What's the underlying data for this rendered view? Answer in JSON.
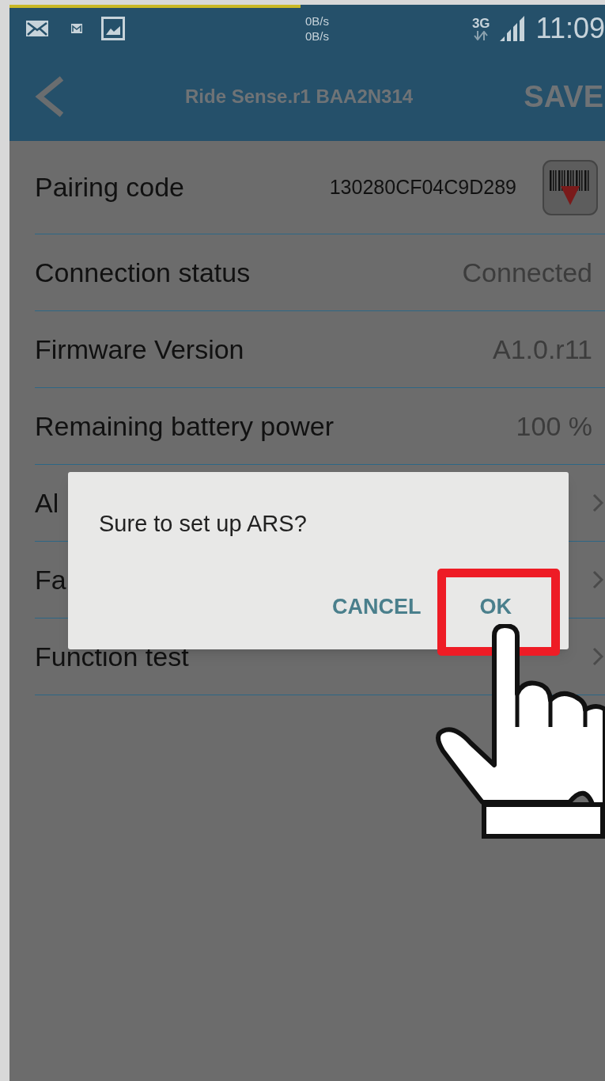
{
  "status_bar": {
    "net_up": "0B/s",
    "net_down": "0B/s",
    "network": "3G",
    "time": "11:09"
  },
  "app_bar": {
    "title": "Ride Sense.r1 BAA2N314",
    "action": "SAVE"
  },
  "rows": [
    {
      "kind": "code",
      "label": "Pairing code",
      "value": "130280CF04C9D289"
    },
    {
      "kind": "value",
      "label": "Connection status",
      "value": "Connected"
    },
    {
      "kind": "value",
      "label": "Firmware Version",
      "value": "A1.0.r11"
    },
    {
      "kind": "value",
      "label": "Remaining battery power",
      "value": "100 %"
    },
    {
      "kind": "link",
      "label": "Al"
    },
    {
      "kind": "link",
      "label": "Fa"
    },
    {
      "kind": "link",
      "label": "Function test"
    }
  ],
  "dialog": {
    "message": "Sure to set up ARS?",
    "buttons": [
      "CANCEL",
      "OK"
    ]
  }
}
